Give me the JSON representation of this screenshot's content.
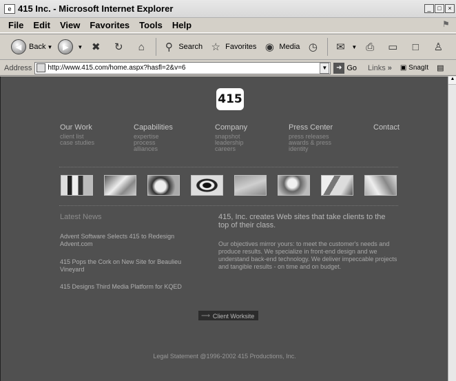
{
  "window": {
    "title": "415 Inc. - Microsoft Internet Explorer"
  },
  "menu": [
    "File",
    "Edit",
    "View",
    "Favorites",
    "Tools",
    "Help"
  ],
  "toolbar": {
    "back": "Back",
    "search": "Search",
    "favorites": "Favorites",
    "media": "Media"
  },
  "address": {
    "label": "Address",
    "url": "http://www.415.com/home.aspx?hasfl=2&v=6",
    "go": "Go",
    "links": "Links",
    "chevron": "»",
    "snagit": "SnagIt"
  },
  "site": {
    "logo": "415",
    "nav": [
      {
        "head": "Our Work",
        "subs": [
          "client list",
          "case studies"
        ]
      },
      {
        "head": "Capabilities",
        "subs": [
          "expertise",
          "process",
          "alliances"
        ]
      },
      {
        "head": "Company",
        "subs": [
          "snapshot",
          "leadership",
          "careers"
        ]
      },
      {
        "head": "Press Center",
        "subs": [
          "press releases",
          "awards & press",
          "identity"
        ]
      },
      {
        "head": "Contact",
        "subs": []
      }
    ],
    "latest_news_title": "Latest News",
    "news": [
      "Advent Software Selects 415 to Redesign Advent.com",
      "415 Pops the Cork on New Site for Beaulieu Vineyard",
      "415 Designs Third Media Platform for KQED"
    ],
    "tagline": "415, Inc. creates Web sites that take clients to the top of their class.",
    "description": "Our objectives mirror yours: to meet the customer's needs and produce results. We specialize in front-end design and we understand back-end technology. We deliver impeccable projects and tangible results - on time and on budget.",
    "worksite_button": "Client Worksite",
    "legal": "Legal Statement @1996-2002 415 Productions, Inc."
  }
}
